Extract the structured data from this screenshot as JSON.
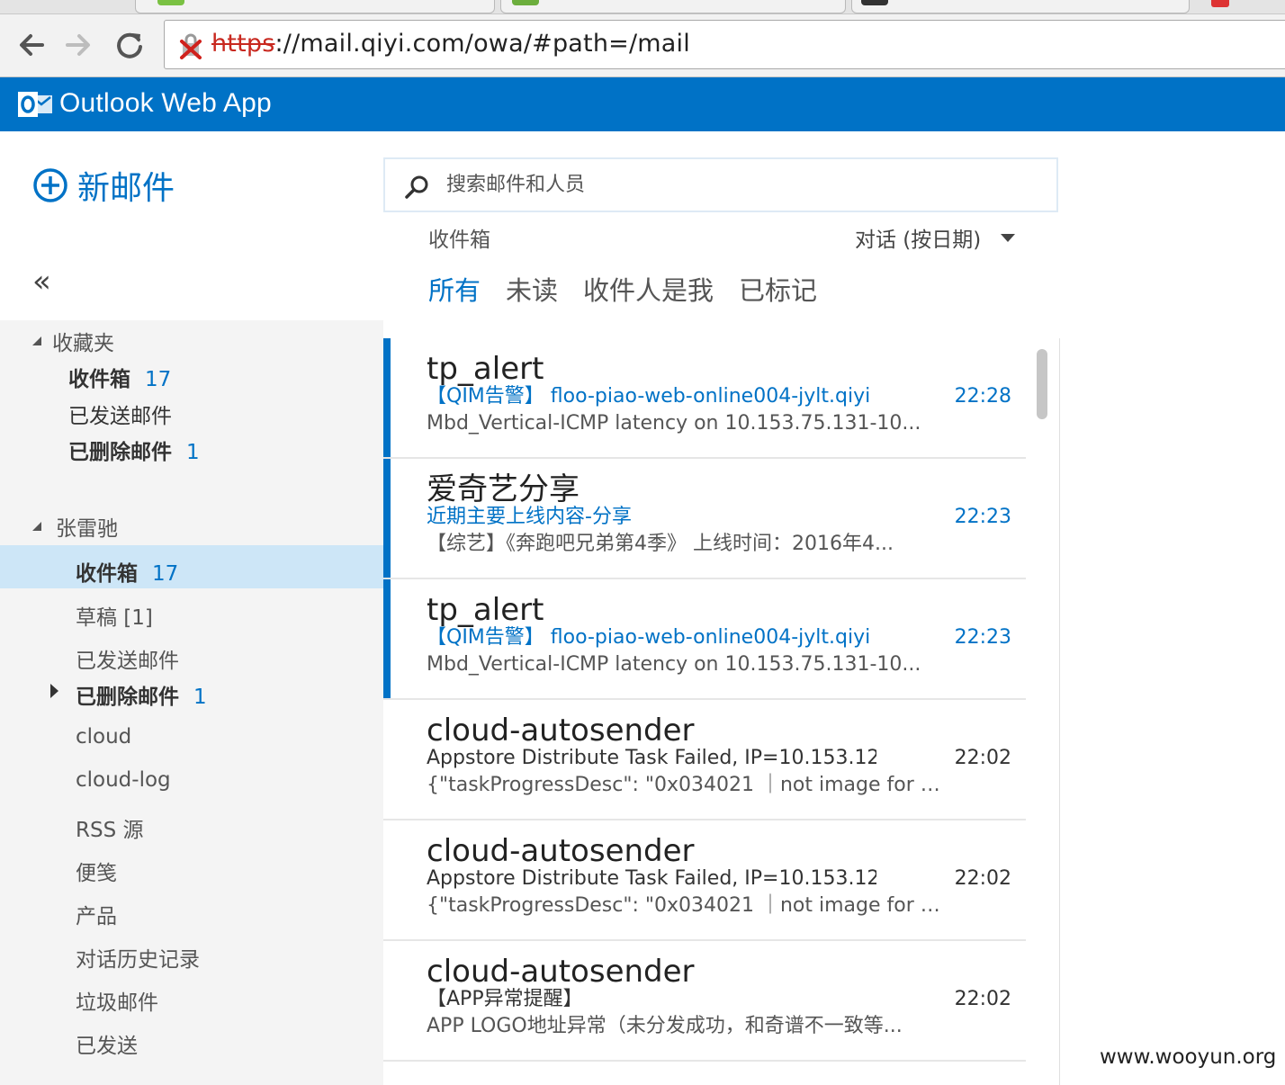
{
  "browser": {
    "url_scheme": "https",
    "url_rest": "://mail.qiyi.com/owa/#path=/mail"
  },
  "app": {
    "title": "Outlook Web App",
    "accent": "#0072c6"
  },
  "leftnav": {
    "new_mail": "新邮件",
    "collapse": "«",
    "favorites": {
      "title": "收藏夹",
      "items": [
        {
          "label": "收件箱",
          "count": "17"
        },
        {
          "label": "已发送邮件",
          "count": ""
        },
        {
          "label": "已删除邮件",
          "count": "1"
        }
      ]
    },
    "account": {
      "title": "张雷驰",
      "items": [
        {
          "label": "收件箱",
          "count": "17"
        },
        {
          "label": "草稿 [1]",
          "count": ""
        },
        {
          "label": "已发送邮件",
          "count": ""
        },
        {
          "label": "已删除邮件",
          "count": "1"
        },
        {
          "label": "cloud",
          "count": ""
        },
        {
          "label": "cloud-log",
          "count": ""
        },
        {
          "label": "RSS 源",
          "count": ""
        },
        {
          "label": "便笺",
          "count": ""
        },
        {
          "label": "产品",
          "count": ""
        },
        {
          "label": "对话历史记录",
          "count": ""
        },
        {
          "label": "垃圾邮件",
          "count": ""
        },
        {
          "label": "已发送",
          "count": ""
        }
      ]
    }
  },
  "search": {
    "placeholder": "搜索邮件和人员"
  },
  "list_header": {
    "folder": "收件箱",
    "sort": "对话 (按日期)",
    "filters": [
      "所有",
      "未读",
      "收件人是我",
      "已标记"
    ]
  },
  "messages": [
    {
      "sender": "tp_alert",
      "subject": "【QIM告警】 floo-piao-web-online004-jylt.qiyi",
      "time": "22:28",
      "preview": "Mbd_Vertical-ICMP latency on 10.153.75.131-10...",
      "unread": true
    },
    {
      "sender": "爱奇艺分享",
      "subject": "近期主要上线内容-分享",
      "time": "22:23",
      "preview": "【综艺】《奔跑吧兄弟第4季》 上线时间：2016年4...",
      "unread": true
    },
    {
      "sender": "tp_alert",
      "subject": "【QIM告警】 floo-piao-web-online004-jylt.qiyi",
      "time": "22:23",
      "preview": "Mbd_Vertical-ICMP latency on 10.153.75.131-10...",
      "unread": true
    },
    {
      "sender": "cloud-autosender",
      "subject": "Appstore Distribute Task Failed, IP=10.153.12",
      "time": "22:02",
      "preview": "{\"taskProgressDesc\": \"0x034021 ｜not image for u...",
      "unread": false
    },
    {
      "sender": "cloud-autosender",
      "subject": "Appstore Distribute Task Failed, IP=10.153.12",
      "time": "22:02",
      "preview": "{\"taskProgressDesc\": \"0x034021 ｜not image for u...",
      "unread": false
    },
    {
      "sender": "cloud-autosender",
      "subject": "【APP异常提醒】",
      "time": "22:02",
      "preview": "APP LOGO地址异常（未分发成功，和奇谱不一致等...",
      "unread": false
    }
  ],
  "watermark": "www.wooyun.org"
}
